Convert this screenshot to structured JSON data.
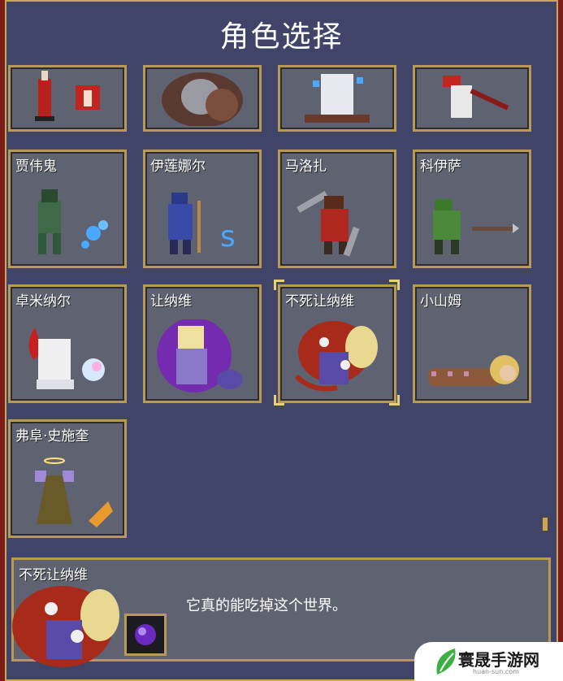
{
  "title": "角色选择",
  "top_row": [
    {
      "name": ""
    },
    {
      "name": ""
    },
    {
      "name": ""
    },
    {
      "name": ""
    }
  ],
  "rows": [
    [
      {
        "name": "贾伟鬼"
      },
      {
        "name": "伊莲娜尔"
      },
      {
        "name": "马洛扎"
      },
      {
        "name": "科伊萨"
      }
    ],
    [
      {
        "name": "卓米纳尔"
      },
      {
        "name": "让纳维"
      },
      {
        "name": "不死让纳维",
        "selected": true
      },
      {
        "name": "小山姆"
      }
    ],
    [
      {
        "name": "弗阜·史施奎"
      }
    ]
  ],
  "info_panel": {
    "name": "不死让纳维",
    "description": "它真的能吃掉这个世界。",
    "weapon_icon": "purple-orb-icon"
  },
  "watermark": {
    "text": "寰晟手游网",
    "url": "huan-sun.com"
  },
  "colors": {
    "panel": "#3f4468",
    "card": "#5f6270",
    "border_gold": "#b89a54",
    "selection": "#e8cf7a"
  }
}
